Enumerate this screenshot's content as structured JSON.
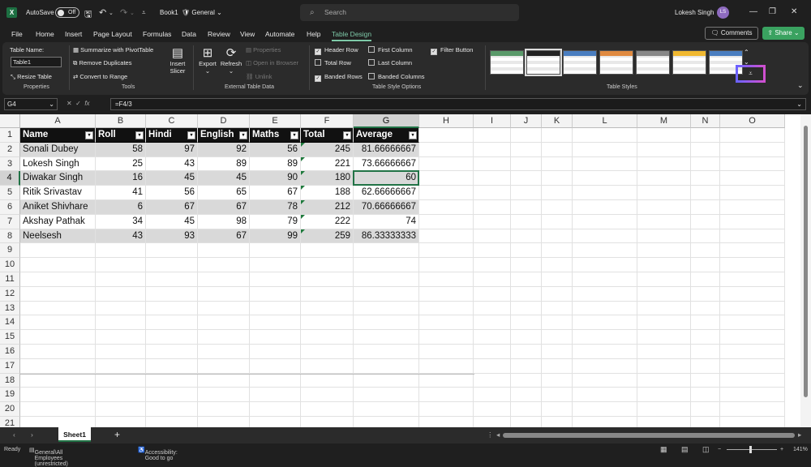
{
  "titlebar": {
    "autosave_label": "AutoSave",
    "autosave_state": "Off",
    "book_name": "Book1",
    "sensitivity": "General",
    "search_placeholder": "Search",
    "user_name": "Lokesh Singh",
    "user_initials": "LS"
  },
  "menu": {
    "items": [
      "File",
      "Home",
      "Insert",
      "Page Layout",
      "Formulas",
      "Data",
      "Review",
      "View",
      "Automate",
      "Help",
      "Table Design"
    ],
    "comments": "Comments",
    "share": "Share"
  },
  "ribbon": {
    "table_name_label": "Table Name:",
    "table_name_value": "Table1",
    "resize_table": "Resize Table",
    "properties_group": "Properties",
    "summarize": "Summarize with PivotTable",
    "remove_duplicates": "Remove Duplicates",
    "convert_range": "Convert to Range",
    "tools_group": "Tools",
    "insert_slicer_1": "Insert",
    "insert_slicer_2": "Slicer",
    "export": "Export",
    "refresh": "Refresh",
    "properties": "Properties",
    "open_in_browser": "Open in Browser",
    "unlink": "Unlink",
    "external_group": "External Table Data",
    "header_row": "Header Row",
    "total_row": "Total Row",
    "banded_rows": "Banded Rows",
    "first_column": "First Column",
    "last_column": "Last Column",
    "banded_columns": "Banded Columns",
    "filter_button": "Filter Button",
    "style_options_group": "Table Style Options",
    "table_styles_group": "Table Styles",
    "style_thumb_colors": [
      "#5a9a6a",
      "#222222",
      "#4a7ec0",
      "#e08a40",
      "#888888",
      "#f0b830",
      "#4a7ec0"
    ]
  },
  "formula": {
    "name_box": "G4",
    "fx": "fx",
    "formula": "=F4/3"
  },
  "sheet": {
    "columns": [
      "A",
      "B",
      "C",
      "D",
      "E",
      "F",
      "G",
      "H",
      "I",
      "J",
      "K",
      "L",
      "M",
      "N",
      "O"
    ],
    "rows": [
      "1",
      "2",
      "3",
      "4",
      "5",
      "6",
      "7",
      "8",
      "9",
      "10",
      "11",
      "12",
      "13",
      "14",
      "15",
      "16",
      "17",
      "18",
      "19",
      "20",
      "21"
    ],
    "table_headers": [
      "Name",
      "Roll",
      "Hindi",
      "English",
      "Maths",
      "Total",
      "Average"
    ],
    "table_rows": [
      [
        "Sonali Dubey",
        "58",
        "97",
        "92",
        "56",
        "245",
        "81.66666667"
      ],
      [
        "Lokesh Singh",
        "25",
        "43",
        "89",
        "89",
        "221",
        "73.66666667"
      ],
      [
        "Diwakar Singh",
        "16",
        "45",
        "45",
        "90",
        "180",
        "60"
      ],
      [
        "Ritik Srivastav",
        "41",
        "56",
        "65",
        "67",
        "188",
        "62.66666667"
      ],
      [
        "Aniket Shivhare",
        "6",
        "67",
        "67",
        "78",
        "212",
        "70.66666667"
      ],
      [
        "Akshay Pathak",
        "34",
        "45",
        "98",
        "79",
        "222",
        "74"
      ],
      [
        "Neelsesh",
        "43",
        "93",
        "67",
        "99",
        "259",
        "86.33333333"
      ]
    ]
  },
  "sheetbar": {
    "tab": "Sheet1",
    "add": "+"
  },
  "status": {
    "ready": "Ready",
    "sensitivity": "General\\All Employees (unrestricted)",
    "accessibility": "Accessibility: Good to go",
    "zoom": "141%"
  }
}
